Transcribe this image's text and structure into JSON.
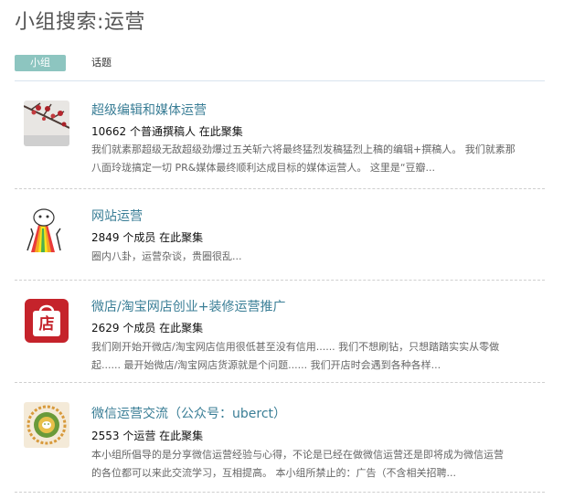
{
  "title": "小组搜索:运营",
  "tabs": {
    "groups": "小组",
    "topics": "话题"
  },
  "colors": {
    "tab_active_bg": "#8dc5c0",
    "group_link": "#3a7e96"
  },
  "groups": [
    {
      "name": "超级编辑和媒体运营",
      "stats": "10662 个普通撰稿人 在此聚集",
      "desc_lines": [
        "我们就素那超级无敌超级劲爆过五关斩六将最终猛烈发稿猛烈上稿的编辑+撰稿人。 我们就素那",
        "八面玲珑搞定一切 PR&媒体最终顺利达成目标的媒体运营人。 这里是“豆瓣..."
      ],
      "icon": "branch-photo-icon"
    },
    {
      "name": "网站运营",
      "stats": "2849 个成员 在此聚集",
      "desc_lines": [
        "圈内八卦，运营杂谈，贵圈很乱..."
      ],
      "icon": "rainbow-puke-icon"
    },
    {
      "name": "微店/淘宝网店创业+装修运营推广",
      "stats": "2629 个成员 在此聚集",
      "desc_lines": [
        "我们刚开始开微店/淘宝网店信用很低甚至没有信用...... 我们不想刷钻，只想踏踏实实从零做",
        "起...... 最开始微店/淘宝网店货源就是个问题...... 我们开店时会遇到各种各样..."
      ],
      "icon": "shop-bag-icon",
      "icon_text": "店"
    },
    {
      "name": "微信运营交流（公众号：uberct）",
      "stats": "2553 个运营 在此聚集",
      "desc_lines": [
        "本小组所倡导的是分享微信运营经验与心得，不论是已经在做微信运营还是即将成为微信运营",
        "的各位都可以来此交流学习，互相提高。 本小组所禁止的：广告（不含相关招聘..."
      ],
      "icon": "wechat-emblem-icon"
    }
  ]
}
